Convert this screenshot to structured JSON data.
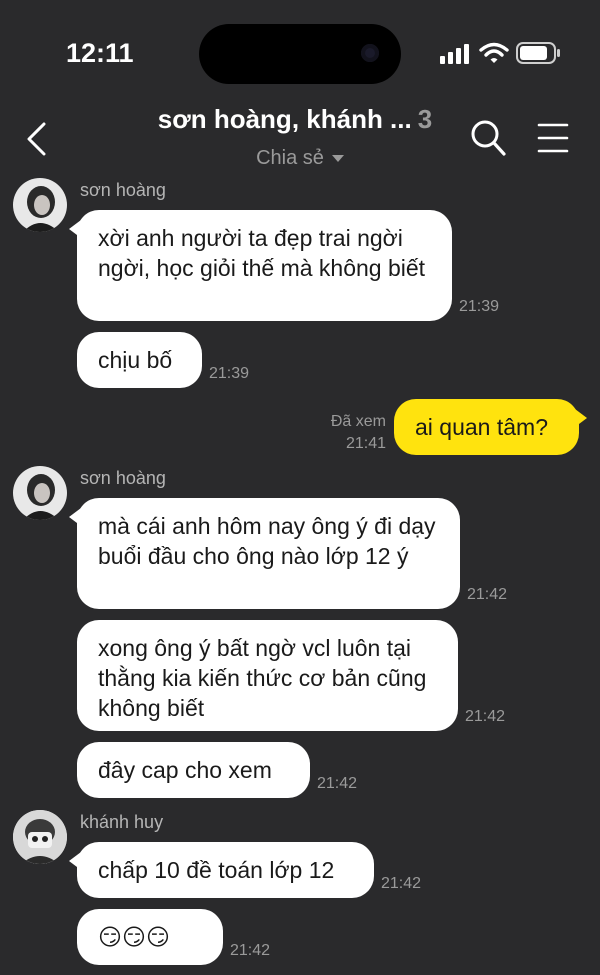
{
  "status_bar": {
    "time": "12:11"
  },
  "header": {
    "title": "sơn hoàng, khánh ...",
    "member_count": "3",
    "subtitle": "Chia sẻ"
  },
  "messages": [
    {
      "sender": "sơn hoàng",
      "text": "xời anh người ta đẹp trai ngời ngời, học giỏi thế mà không biết",
      "time": "21:39"
    },
    {
      "sender": "sơn hoàng",
      "text": "chịu bố",
      "time": "21:39"
    },
    {
      "sender": "me",
      "text": "ai quan tâm?",
      "time": "21:41",
      "status": "Đã xem"
    },
    {
      "sender": "sơn hoàng",
      "text": "mà cái anh hôm nay ông ý đi dạy buổi đầu cho ông nào lớp 12 ý",
      "time": "21:42"
    },
    {
      "sender": "sơn hoàng",
      "text": "xong ông ý bất ngờ vcl luôn tại thằng kia kiến thức cơ bản cũng không biết",
      "time": "21:42"
    },
    {
      "sender": "sơn hoàng",
      "text": "đây cap cho xem",
      "time": "21:42"
    },
    {
      "sender": "khánh huy",
      "text": "chấp 10 đề toán lớp 12",
      "time": "21:42"
    },
    {
      "sender": "khánh huy",
      "text": "😏😏😏",
      "time": "21:42"
    }
  ],
  "icons": {
    "back": "chevron-left-icon",
    "search": "search-icon",
    "menu": "menu-icon",
    "signal": "signal-icon",
    "wifi": "wifi-icon",
    "battery": "battery-icon"
  },
  "colors": {
    "background": "#2a2a2c",
    "incoming_bubble": "#ffffff",
    "outgoing_bubble": "#ffe30e"
  }
}
